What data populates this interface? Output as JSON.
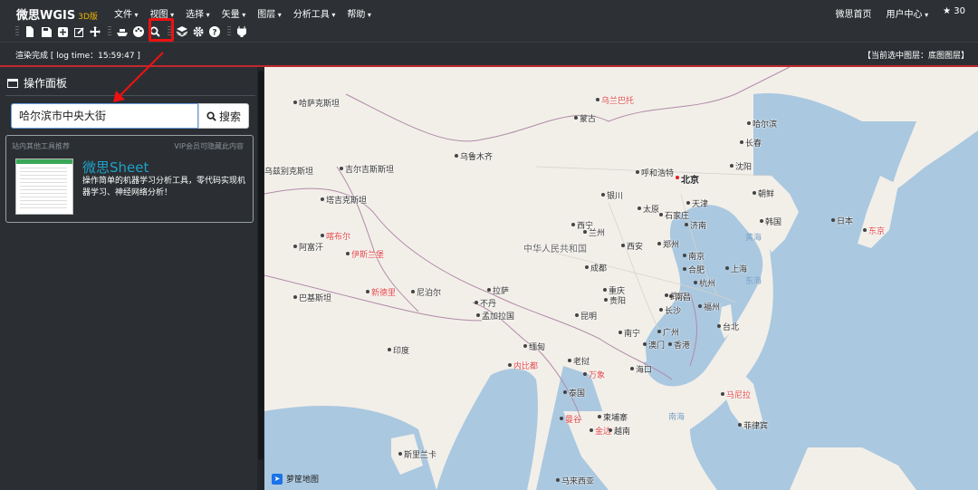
{
  "header": {
    "brand": "微思WGIS",
    "version": "3D版",
    "menus": [
      "文件",
      "视图",
      "选择",
      "矢量",
      "图层",
      "分析工具",
      "帮助"
    ],
    "home_link": "微思首页",
    "user_center": "用户中心",
    "star_count": "30"
  },
  "toolbar": {
    "icons": [
      "new-file-icon",
      "save-icon",
      "add-icon",
      "edit-icon",
      "move-icon",
      "ship-icon",
      "palette-icon",
      "search-icon",
      "layers-icon",
      "settings-icon",
      "help-icon",
      "plug-icon"
    ],
    "highlighted_tool": "search-icon",
    "highlight_color": "#e11111"
  },
  "status": {
    "left": "渲染完成 [ log time：15:59:47 ]",
    "right": "【当前选中图层：底图图层】"
  },
  "panel": {
    "title": "操作面板",
    "search_value": "哈尔滨市中央大街",
    "search_button": "搜索",
    "recommend_header": "站内其他工具推荐",
    "vip_hint": "VIP会员可隐藏此内容",
    "recommend_name": "微思Sheet",
    "recommend_desc": "操作简单的机器学习分析工具，零代码实现机器学习、神经网络分析！"
  },
  "map": {
    "attribution": "萝筐地图",
    "labels": [
      {
        "t": "乌兰巴托",
        "c": "red"
      },
      {
        "t": "蒙古",
        "c": ""
      },
      {
        "t": "哈萨克斯坦",
        "c": ""
      },
      {
        "t": "乌鲁木齐",
        "c": ""
      },
      {
        "t": "乌兹别克斯坦",
        "c": ""
      },
      {
        "t": "吉尔吉斯斯坦",
        "c": ""
      },
      {
        "t": "塔吉克斯坦",
        "c": ""
      },
      {
        "t": "伊斯兰堡",
        "c": "red"
      },
      {
        "t": "喀布尔",
        "c": "red"
      },
      {
        "t": "阿富汗",
        "c": ""
      },
      {
        "t": "巴基斯坦",
        "c": ""
      },
      {
        "t": "新德里",
        "c": "red"
      },
      {
        "t": "尼泊尔",
        "c": ""
      },
      {
        "t": "拉萨",
        "c": ""
      },
      {
        "t": "不丹",
        "c": ""
      },
      {
        "t": "印度",
        "c": ""
      },
      {
        "t": "孟加拉国",
        "c": ""
      },
      {
        "t": "缅甸",
        "c": ""
      },
      {
        "t": "内比都",
        "c": "red"
      },
      {
        "t": "老挝",
        "c": ""
      },
      {
        "t": "万象",
        "c": "red"
      },
      {
        "t": "泰国",
        "c": ""
      },
      {
        "t": "曼谷",
        "c": "red"
      },
      {
        "t": "柬埔寨",
        "c": ""
      },
      {
        "t": "金边",
        "c": "red"
      },
      {
        "t": "越南",
        "c": ""
      },
      {
        "t": "斯里兰卡",
        "c": ""
      },
      {
        "t": "马来西亚",
        "c": ""
      },
      {
        "t": "中华人民共和国",
        "c": "big"
      },
      {
        "t": "北京",
        "c": "cap"
      },
      {
        "t": "天津",
        "c": ""
      },
      {
        "t": "石家庄",
        "c": ""
      },
      {
        "t": "太原",
        "c": ""
      },
      {
        "t": "呼和浩特",
        "c": ""
      },
      {
        "t": "银川",
        "c": ""
      },
      {
        "t": "西宁",
        "c": ""
      },
      {
        "t": "兰州",
        "c": ""
      },
      {
        "t": "西安",
        "c": ""
      },
      {
        "t": "郑州",
        "c": ""
      },
      {
        "t": "济南",
        "c": ""
      },
      {
        "t": "南京",
        "c": ""
      },
      {
        "t": "合肥",
        "c": ""
      },
      {
        "t": "上海",
        "c": ""
      },
      {
        "t": "杭州",
        "c": ""
      },
      {
        "t": "武汉",
        "c": ""
      },
      {
        "t": "成都",
        "c": ""
      },
      {
        "t": "重庆",
        "c": ""
      },
      {
        "t": "贵阳",
        "c": ""
      },
      {
        "t": "长沙",
        "c": ""
      },
      {
        "t": "南昌",
        "c": ""
      },
      {
        "t": "福州",
        "c": ""
      },
      {
        "t": "台北",
        "c": ""
      },
      {
        "t": "昆明",
        "c": ""
      },
      {
        "t": "南宁",
        "c": ""
      },
      {
        "t": "广州",
        "c": ""
      },
      {
        "t": "澳门",
        "c": ""
      },
      {
        "t": "香港",
        "c": ""
      },
      {
        "t": "海口",
        "c": ""
      },
      {
        "t": "沈阳",
        "c": ""
      },
      {
        "t": "长春",
        "c": ""
      },
      {
        "t": "哈尔滨",
        "c": ""
      },
      {
        "t": "朝鲜",
        "c": ""
      },
      {
        "t": "韩国",
        "c": ""
      },
      {
        "t": "日本",
        "c": ""
      },
      {
        "t": "东京",
        "c": "red"
      },
      {
        "t": "菲律宾",
        "c": ""
      },
      {
        "t": "马尼拉",
        "c": "red"
      },
      {
        "t": "黄海",
        "c": "water"
      },
      {
        "t": "东海",
        "c": "water"
      },
      {
        "t": "南海",
        "c": "water"
      }
    ]
  }
}
